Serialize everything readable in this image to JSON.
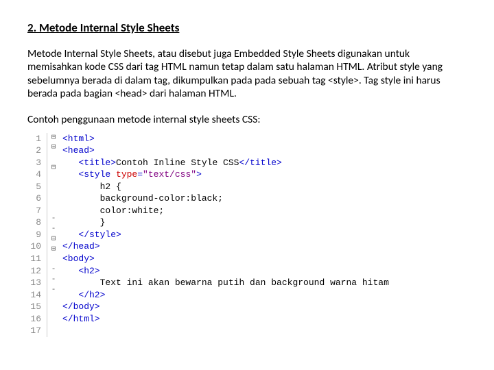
{
  "heading": "2. Metode Internal Style Sheets",
  "paragraph": "Metode Internal Style Sheets, atau disebut juga Embedded Style Sheets digunakan untuk memisahkan kode CSS dari tag HTML namun tetap dalam satu halaman HTML. Atribut style yang sebelumnya berada di dalam tag, dikumpulkan pada pada sebuah tag <style>. Tag style ini harus berada pada bagian <head> dari halaman HTML.",
  "example_label": "Contoh penggunaan metode internal style sheets CSS:",
  "code": {
    "lines": [
      {
        "num": "1",
        "fold": "⊟",
        "c": [
          {
            "t": "tag",
            "v": "<html>"
          }
        ]
      },
      {
        "num": "2",
        "fold": "⊟",
        "c": [
          {
            "t": "tag",
            "v": "<head>"
          }
        ]
      },
      {
        "num": "3",
        "fold": "",
        "c": [
          {
            "t": "text",
            "v": "   "
          },
          {
            "t": "tag",
            "v": "<title>"
          },
          {
            "t": "text",
            "v": "Contoh Inline Style CSS"
          },
          {
            "t": "tag",
            "v": "</title>"
          }
        ]
      },
      {
        "num": "4",
        "fold": "⊟",
        "c": [
          {
            "t": "text",
            "v": "   "
          },
          {
            "t": "tag",
            "v": "<style "
          },
          {
            "t": "attr",
            "v": "type"
          },
          {
            "t": "tag",
            "v": "="
          },
          {
            "t": "str",
            "v": "\"text/css\""
          },
          {
            "t": "tag",
            "v": ">"
          }
        ]
      },
      {
        "num": "5",
        "fold": "",
        "c": [
          {
            "t": "text",
            "v": "       h2 {"
          }
        ]
      },
      {
        "num": "6",
        "fold": "",
        "c": [
          {
            "t": "text",
            "v": "       background-color:black;"
          }
        ]
      },
      {
        "num": "7",
        "fold": "",
        "c": [
          {
            "t": "text",
            "v": "       color:white;"
          }
        ]
      },
      {
        "num": "8",
        "fold": "",
        "c": [
          {
            "t": "text",
            "v": "       }"
          }
        ]
      },
      {
        "num": "9",
        "fold": "-",
        "c": [
          {
            "t": "text",
            "v": "   "
          },
          {
            "t": "tag",
            "v": "</style>"
          }
        ]
      },
      {
        "num": "10",
        "fold": "-",
        "c": [
          {
            "t": "tag",
            "v": "</head>"
          }
        ]
      },
      {
        "num": "11",
        "fold": "⊟",
        "c": [
          {
            "t": "tag",
            "v": "<body>"
          }
        ]
      },
      {
        "num": "12",
        "fold": "⊟",
        "c": [
          {
            "t": "text",
            "v": "   "
          },
          {
            "t": "tag",
            "v": "<h2>"
          }
        ]
      },
      {
        "num": "13",
        "fold": "",
        "c": [
          {
            "t": "text",
            "v": "       Text ini akan bewarna putih dan background warna hitam"
          }
        ]
      },
      {
        "num": "14",
        "fold": "-",
        "c": [
          {
            "t": "text",
            "v": "   "
          },
          {
            "t": "tag",
            "v": "</h2>"
          }
        ]
      },
      {
        "num": "15",
        "fold": "-",
        "c": [
          {
            "t": "tag",
            "v": "</body>"
          }
        ]
      },
      {
        "num": "16",
        "fold": "-",
        "c": [
          {
            "t": "tag",
            "v": "</html>"
          }
        ]
      },
      {
        "num": "17",
        "fold": "",
        "c": [
          {
            "t": "text",
            "v": ""
          }
        ]
      }
    ]
  }
}
